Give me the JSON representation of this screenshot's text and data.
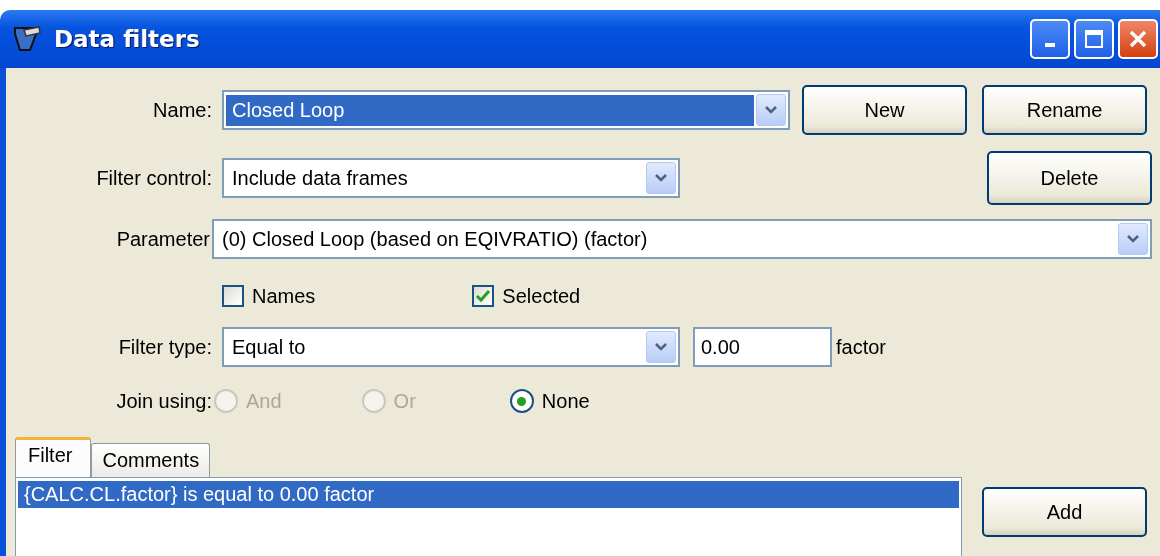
{
  "window": {
    "title": "Data filters"
  },
  "name": {
    "label": "Name:",
    "value": "Closed Loop",
    "highlighted": true
  },
  "filter_control": {
    "label": "Filter control:",
    "value": "Include data frames"
  },
  "parameter": {
    "label": "Parameter",
    "value": "(0) Closed Loop (based on EQIVRATIO) (factor)"
  },
  "checkboxes": [
    {
      "label": "Names",
      "checked": false
    },
    {
      "label": "Selected",
      "checked": true
    }
  ],
  "filter_type": {
    "label": "Filter type:",
    "value": "Equal to",
    "threshold": "0.00",
    "unit": "factor"
  },
  "join": {
    "label": "Join using:",
    "options": [
      {
        "label": "And",
        "selected": false,
        "disabled": true
      },
      {
        "label": "Or",
        "selected": false,
        "disabled": true
      },
      {
        "label": "None",
        "selected": true,
        "disabled": false
      }
    ]
  },
  "tabs": [
    {
      "label": "Filter",
      "selected": true
    },
    {
      "label": "Comments",
      "selected": false
    }
  ],
  "filter_list": [
    {
      "text": "{CALC.CL.factor} is equal to 0.00 factor",
      "selected": true
    }
  ],
  "buttons": {
    "new": "New",
    "rename": "Rename",
    "delete": "Delete",
    "add": "Add"
  }
}
